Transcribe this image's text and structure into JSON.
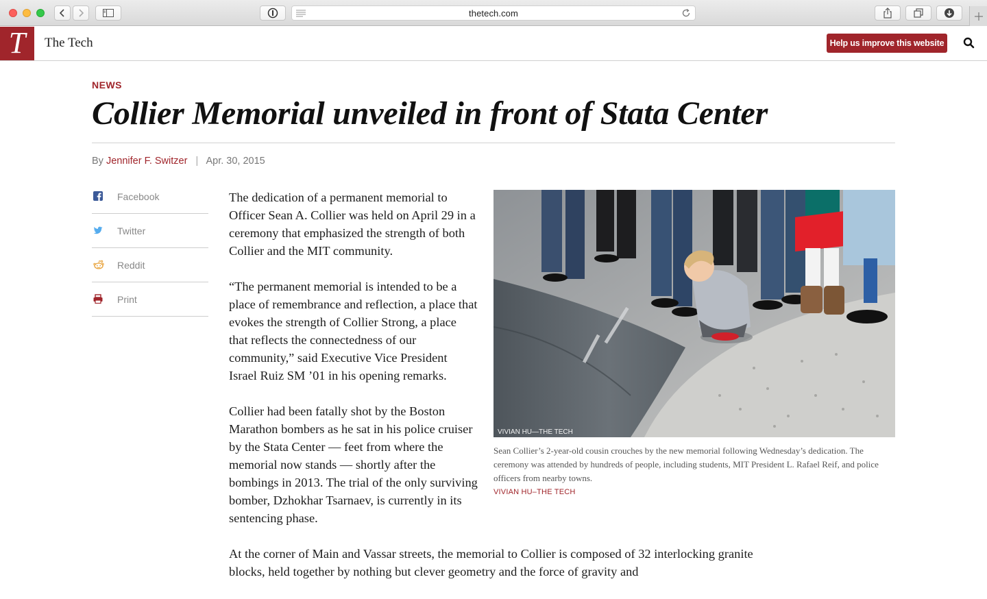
{
  "browser": {
    "url": "thetech.com"
  },
  "site": {
    "logo_letter": "T",
    "name": "The Tech",
    "help_button": "Help us improve this website"
  },
  "article": {
    "section": "NEWS",
    "headline": "Collier Memorial unveiled in front of Stata Center",
    "byline_prefix": "By",
    "author": "Jennifer F. Switzer",
    "separator": "|",
    "date": "Apr. 30, 2015",
    "paragraphs": [
      "The dedication of a permanent memorial to Officer Sean A. Collier was held on April 29 in a ceremony that emphasized the strength of both Collier and the MIT community.",
      "“The permanent memorial is intended to be a place of remembrance and reflection, a place that evokes the strength of Collier Strong, a place that reflects the connectedness of our community,” said Executive Vice President Israel Ruiz SM ’01 in his opening remarks.",
      "Collier had been fatally shot by the Boston Marathon bombers as he sat in his police cruiser by the Stata Center — feet from where the memorial now stands — shortly after the bombings in 2013. The trial of the only surviving bomber, Dzhokhar Tsarnaev, is currently in its sentencing phase.",
      "At the corner of Main and Vassar streets, the memorial to Collier is composed of 32 interlocking granite blocks, held together by nothing but clever geometry and the force of gravity and"
    ],
    "figure": {
      "photo_overlay_credit": "VIVIAN HU—THE TECH",
      "caption": "Sean Collier’s 2-year-old cousin crouches by the new memorial following Wednesday’s dedication. The ceremony was attended by hundreds of people, including students, MIT President L. Rafael Reif, and police officers from nearby towns.",
      "credit": "VIVIAN HU–THE TECH"
    }
  },
  "share": [
    {
      "label": "Facebook",
      "icon": "facebook-icon",
      "color": "#3b5998"
    },
    {
      "label": "Twitter",
      "icon": "twitter-icon",
      "color": "#55acee"
    },
    {
      "label": "Reddit",
      "icon": "reddit-icon",
      "color": "#e8a23a"
    },
    {
      "label": "Print",
      "icon": "printer-icon",
      "color": "#a0252b"
    }
  ],
  "colors": {
    "brand": "#a0252b"
  }
}
